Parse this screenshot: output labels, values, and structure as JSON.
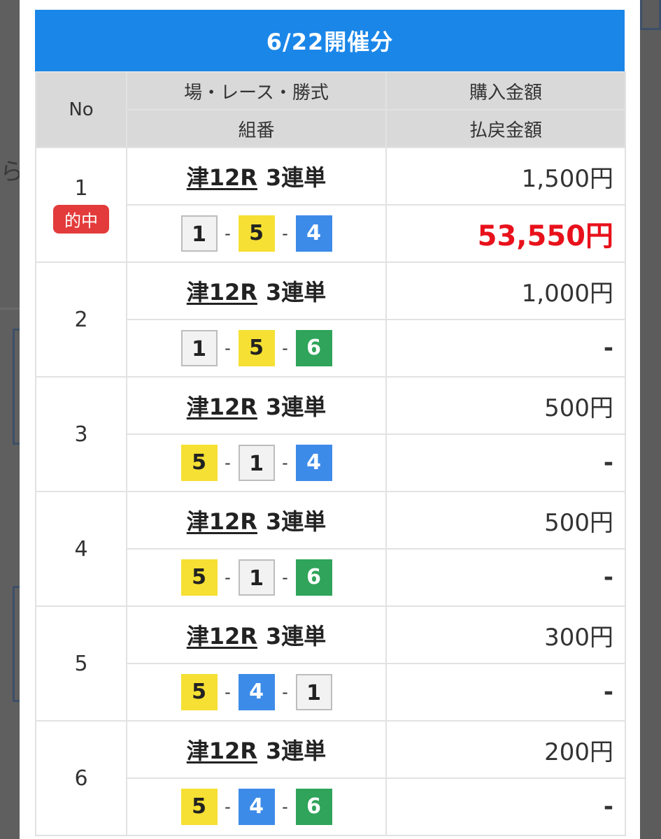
{
  "title": "6/22開催分",
  "backdrop_text": "ら",
  "headers": {
    "no": "No",
    "race": "場・レース・勝式",
    "combo": "組番",
    "bet": "購入金額",
    "payout": "払戻金額"
  },
  "hit_badge": "的中",
  "rows": [
    {
      "no": "1",
      "venue_race": "津12R",
      "bet_type": "3連単",
      "combo": [
        "1",
        "5",
        "4"
      ],
      "bet": "1,500円",
      "payout": "53,550円",
      "hit": true
    },
    {
      "no": "2",
      "venue_race": "津12R",
      "bet_type": "3連単",
      "combo": [
        "1",
        "5",
        "6"
      ],
      "bet": "1,000円",
      "payout": "-",
      "hit": false
    },
    {
      "no": "3",
      "venue_race": "津12R",
      "bet_type": "3連単",
      "combo": [
        "5",
        "1",
        "4"
      ],
      "bet": "500円",
      "payout": "-",
      "hit": false
    },
    {
      "no": "4",
      "venue_race": "津12R",
      "bet_type": "3連単",
      "combo": [
        "5",
        "1",
        "6"
      ],
      "bet": "500円",
      "payout": "-",
      "hit": false
    },
    {
      "no": "5",
      "venue_race": "津12R",
      "bet_type": "3連単",
      "combo": [
        "5",
        "4",
        "1"
      ],
      "bet": "300円",
      "payout": "-",
      "hit": false
    },
    {
      "no": "6",
      "venue_race": "津12R",
      "bet_type": "3連単",
      "combo": [
        "5",
        "4",
        "6"
      ],
      "bet": "200円",
      "payout": "-",
      "hit": false
    }
  ],
  "boat_colors": {
    "1": "#f2f2f2",
    "4": "#3d8be8",
    "5": "#f5e033",
    "6": "#2fa45a"
  }
}
